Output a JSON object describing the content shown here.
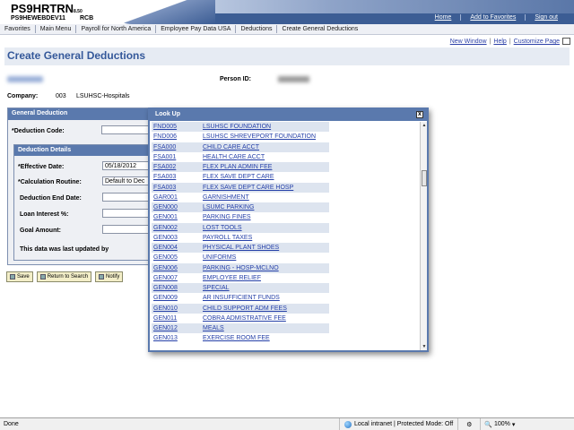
{
  "banner": {
    "system_title": "PS9HRTRN",
    "version": "8.50",
    "database": "PS9HEWEBDEV11",
    "user_code": "RCB",
    "links": [
      "Home",
      "Add to Favorites",
      "Sign out"
    ]
  },
  "menu": [
    "Favorites",
    "Main Menu",
    "Payroll for North America",
    "Employee Pay Data USA",
    "Deductions",
    "Create General Deductions"
  ],
  "page_links": {
    "new_window": "New Window",
    "help": "Help",
    "customize": "Customize Page"
  },
  "page": {
    "title": "Create General Deductions",
    "person_id_label": "Person ID:",
    "company_label": "Company:",
    "company_code": "003",
    "company_name": "LSUHSC-Hospitals"
  },
  "general_deduction": {
    "header": "General Deduction",
    "deduction_code_label": "*Deduction Code:",
    "details_header": "Deduction Details",
    "effective_date_label": "*Effective Date:",
    "effective_date_value": "05/18/2012",
    "calc_routine_label": "*Calculation Routine:",
    "calc_routine_value": "Default to Dec",
    "end_date_label": "Deduction End Date:",
    "loan_interest_label": "Loan Interest %:",
    "goal_amount_label": "Goal Amount:",
    "last_updated_label": "This data was last updated by"
  },
  "buttons": [
    "Save",
    "Return to Search",
    "Notify"
  ],
  "lookup": {
    "title": "Look Up",
    "close": "x",
    "rows": [
      {
        "code": "FND005",
        "desc": "LSUHSC FOUNDATION"
      },
      {
        "code": "FND006",
        "desc": "LSUHSC SHREVEPORT FOUNDATION"
      },
      {
        "code": "FSA000",
        "desc": "CHILD CARE ACCT"
      },
      {
        "code": "FSA001",
        "desc": "HEALTH CARE ACCT"
      },
      {
        "code": "FSA002",
        "desc": "FLEX PLAN ADMIN FEE"
      },
      {
        "code": "FSA003",
        "desc": "FLEX SAVE DEPT CARE"
      },
      {
        "code": "FSA003",
        "desc": "FLEX SAVE DEPT CARE HOSP"
      },
      {
        "code": "GAR001",
        "desc": "GARNISHMENT"
      },
      {
        "code": "GEN000",
        "desc": "LSUMC PARKING"
      },
      {
        "code": "GEN001",
        "desc": "PARKING FINES"
      },
      {
        "code": "GEN002",
        "desc": "LOST TOOLS"
      },
      {
        "code": "GEN003",
        "desc": "PAYROLL TAXES"
      },
      {
        "code": "GEN004",
        "desc": "PHYSICAL PLANT SHOES"
      },
      {
        "code": "GEN005",
        "desc": "UNIFORMS"
      },
      {
        "code": "GEN006",
        "desc": "PARKING - HOSP-MCLNO"
      },
      {
        "code": "GEN007",
        "desc": "EMPLOYEE RELIEF"
      },
      {
        "code": "GEN008",
        "desc": "SPECIAL"
      },
      {
        "code": "GEN009",
        "desc": "AR INSUFFICIENT FUNDS"
      },
      {
        "code": "GEN010",
        "desc": "CHILD SUPPORT ADM FEES"
      },
      {
        "code": "GEN011",
        "desc": "COBRA ADMISTRATIVE FEE"
      },
      {
        "code": "GEN012",
        "desc": "MEALS"
      },
      {
        "code": "GEN013",
        "desc": "EXERCISE ROOM FEE"
      }
    ]
  },
  "status": {
    "left": "Done",
    "zone": "Local intranet | Protected Mode: Off",
    "zoom": "100%"
  }
}
